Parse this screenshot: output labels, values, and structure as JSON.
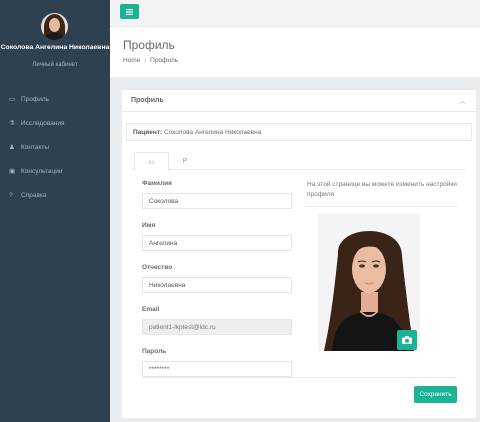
{
  "sidebar": {
    "user_name": "Соколова Ангелина Николаевна",
    "user_role": "Личный кабинет",
    "items": [
      {
        "icon": "id-card-icon",
        "glyph": "▭",
        "label": "Профиль"
      },
      {
        "icon": "flask-icon",
        "glyph": "⚗",
        "label": "Исследования"
      },
      {
        "icon": "contacts-icon",
        "glyph": "♟",
        "label": "Контакты"
      },
      {
        "icon": "briefcase-icon",
        "glyph": "▣",
        "label": "Консультации"
      },
      {
        "icon": "question-icon",
        "glyph": "?",
        "label": "Справка"
      }
    ]
  },
  "header": {
    "menu_icon": "hamburger-icon",
    "page_title": "Профиль",
    "breadcrumb": [
      "Home",
      "Профиль"
    ]
  },
  "panel": {
    "title": "Профиль",
    "patient_label": "Пациент:",
    "patient_name": "Соколова Ангелина Николаевна",
    "tabs": [
      {
        "icon": "id-card-icon",
        "glyph": "▭"
      },
      {
        "icon": "key-icon",
        "glyph": "P"
      }
    ]
  },
  "form": {
    "last_name_label": "Фамилия",
    "last_name_value": "Соколова",
    "first_name_label": "Имя",
    "first_name_value": "Ангелина",
    "patronymic_label": "Отчество",
    "patronymic_value": "Николаевна",
    "email_label": "Email",
    "email_value": "patient1-lkptest@ldc.ru",
    "password_label": "Пароль",
    "password_value": "********"
  },
  "profile_photo": {
    "hint": "На этой странице вы можете изменить настройки профиля",
    "camera_icon": "camera-icon"
  },
  "actions": {
    "save_label": "Сохранить"
  },
  "colors": {
    "sidebar_bg": "#2f4050",
    "accent": "#1ab394",
    "page_bg": "#e9edf0"
  }
}
